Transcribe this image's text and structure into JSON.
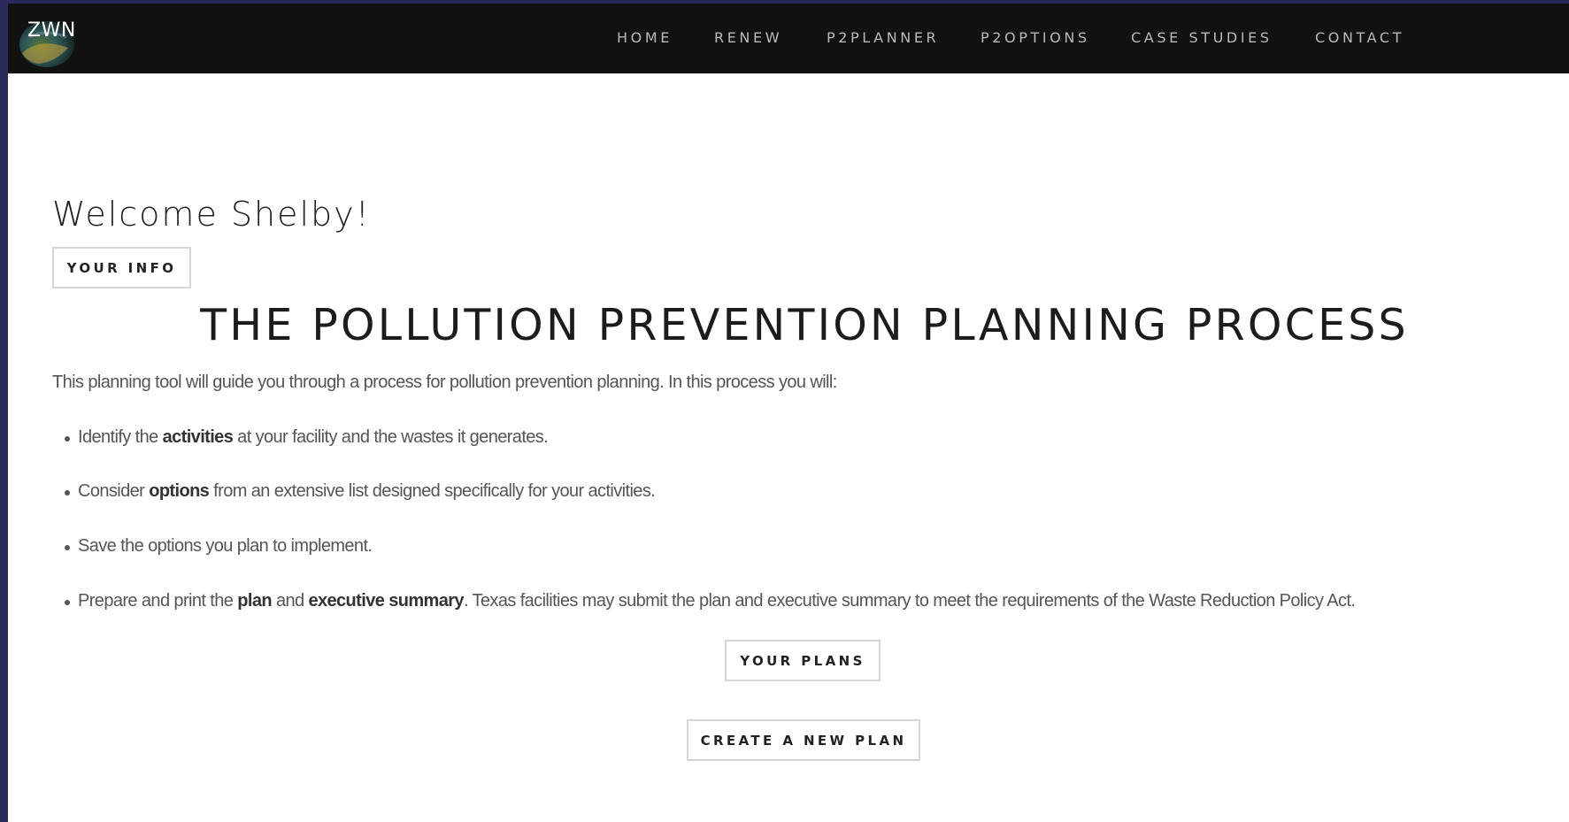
{
  "header": {
    "logo_text": "ZWN",
    "nav": [
      "HOME",
      "RENEW",
      "P2PLANNER",
      "P2OPTIONS",
      "CASE STUDIES",
      "CONTACT"
    ]
  },
  "main": {
    "welcome": "Welcome Shelby!",
    "your_info_label": "YOUR INFO",
    "title": "THE POLLUTION PREVENTION PLANNING PROCESS",
    "intro": "This planning tool will guide you through a process for pollution prevention planning. In this process you will:",
    "bullets": [
      {
        "b1_pre": "Identify the ",
        "b1_bold": "activities",
        "b1_post": " at your facility and the wastes it generates."
      },
      {
        "b2_pre": "Consider ",
        "b2_bold": "options",
        "b2_post": " from an extensive list designed specifically for your activities."
      },
      {
        "b3_text": "Save the options you plan to implement."
      },
      {
        "b4_pre": "Prepare and print the ",
        "b4_bold1": "plan",
        "b4_mid": " and ",
        "b4_bold2": "executive summary",
        "b4_post": ". Texas facilities may submit the plan and executive summary to meet the requirements of the Waste Reduction Policy Act."
      }
    ],
    "your_plans_label": "YOUR PLANS",
    "create_plan_label": "CREATE A NEW PLAN"
  },
  "colors": {
    "outer_border": "#2a2a5a",
    "topbar": "#111111",
    "nav_text": "#b9b9b9",
    "button_border": "#d6d6d6",
    "body_text": "#555555"
  }
}
